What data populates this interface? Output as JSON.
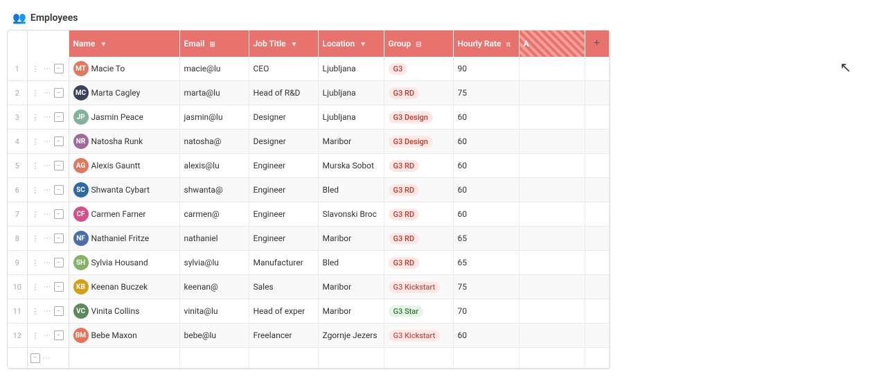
{
  "header": {
    "title": "Employees",
    "icon": "people-icon"
  },
  "columns": [
    {
      "id": "name",
      "label": "Name",
      "sortable": true
    },
    {
      "id": "email",
      "label": "Email",
      "sortable": true
    },
    {
      "id": "jobtitle",
      "label": "Job Title",
      "sortable": true
    },
    {
      "id": "location",
      "label": "Location",
      "sortable": true
    },
    {
      "id": "group",
      "label": "Group",
      "sortable": true,
      "filterable": true
    },
    {
      "id": "hourlyrate",
      "label": "Hourly Rate",
      "sortable": true
    },
    {
      "id": "a",
      "label": "A",
      "hatched": true
    }
  ],
  "rows": [
    {
      "num": 1,
      "name": "Macie To",
      "email": "macie@lu",
      "jobtitle": "CEO",
      "location": "Ljubljana",
      "group": "G3",
      "groupClass": "badge-g3",
      "hourlyrate": "90",
      "avatarColor": "#e07a5f",
      "avatarText": "MT"
    },
    {
      "num": 2,
      "name": "Marta Cagley",
      "email": "marta@lu",
      "jobtitle": "Head of R&D",
      "location": "Ljubljana",
      "group": "G3 RD",
      "groupClass": "badge-g3rd",
      "hourlyrate": "75",
      "avatarColor": "#3d405b",
      "avatarText": "MC"
    },
    {
      "num": 3,
      "name": "Jasmin Peace",
      "email": "jasmin@lu",
      "jobtitle": "Designer",
      "location": "Ljubljana",
      "group": "G3 Design",
      "groupClass": "badge-g3design",
      "hourlyrate": "60",
      "avatarColor": "#81b29a",
      "avatarText": "JP"
    },
    {
      "num": 4,
      "name": "Natosha Runk",
      "email": "natosha@",
      "jobtitle": "Designer",
      "location": "Maribor",
      "group": "G3 Design",
      "groupClass": "badge-g3design",
      "hourlyrate": "60",
      "avatarColor": "#9c6b98",
      "avatarText": "NR"
    },
    {
      "num": 5,
      "name": "Alexis Gauntt",
      "email": "alexis@lu",
      "jobtitle": "Engineer",
      "location": "Murska Sobot",
      "group": "G3 RD",
      "groupClass": "badge-g3rd",
      "hourlyrate": "60",
      "avatarColor": "#e07a5f",
      "avatarText": "AG"
    },
    {
      "num": 6,
      "name": "Shwanta Cybart",
      "email": "shwanta@",
      "jobtitle": "Engineer",
      "location": "Bled",
      "group": "G3 RD",
      "groupClass": "badge-g3rd",
      "hourlyrate": "60",
      "avatarColor": "#2e6aa1",
      "avatarText": "SC"
    },
    {
      "num": 7,
      "name": "Carmen Farner",
      "email": "carmen@",
      "jobtitle": "Engineer",
      "location": "Slavonski Broc",
      "group": "G3 RD",
      "groupClass": "badge-g3rd",
      "hourlyrate": "60",
      "avatarColor": "#d44f8c",
      "avatarText": "CF"
    },
    {
      "num": 8,
      "name": "Nathaniel Fritze",
      "email": "nathaniel",
      "jobtitle": "Engineer",
      "location": "Maribor",
      "group": "G3 RD",
      "groupClass": "badge-g3rd",
      "hourlyrate": "65",
      "avatarColor": "#4a6fa5",
      "avatarText": "NF"
    },
    {
      "num": 9,
      "name": "Sylvia Housand",
      "email": "sylvia@lu",
      "jobtitle": "Manufacturer",
      "location": "Bled",
      "group": "G3 RD",
      "groupClass": "badge-g3rd",
      "hourlyrate": "65",
      "avatarColor": "#82b366",
      "avatarText": "SH"
    },
    {
      "num": 10,
      "name": "Keenan Buczek",
      "email": "keenan@",
      "jobtitle": "Sales",
      "location": "Maribor",
      "group": "G3 Kickstart",
      "groupClass": "badge-g3kickstart",
      "hourlyrate": "75",
      "avatarColor": "#d4a017",
      "avatarText": "KB"
    },
    {
      "num": 11,
      "name": "Vinita Collins",
      "email": "vinita@lu",
      "jobtitle": "Head of exper",
      "location": "Maribor",
      "group": "G3 Star",
      "groupClass": "badge-g3star",
      "hourlyrate": "70",
      "avatarColor": "#5c8a5c",
      "avatarText": "VC"
    },
    {
      "num": 12,
      "name": "Bebe Maxon",
      "email": "bebe@lu",
      "jobtitle": "Freelancer",
      "location": "Zgornje Jezers",
      "group": "G3 Kickstart",
      "groupClass": "badge-g3kickstart",
      "hourlyrate": "60",
      "avatarColor": "#e8735a",
      "avatarText": "BM"
    }
  ],
  "addColumnLabel": "+",
  "ui": {
    "expandIconLabel": "−",
    "dotsLabel": "···",
    "dragLabel": "⋮"
  }
}
